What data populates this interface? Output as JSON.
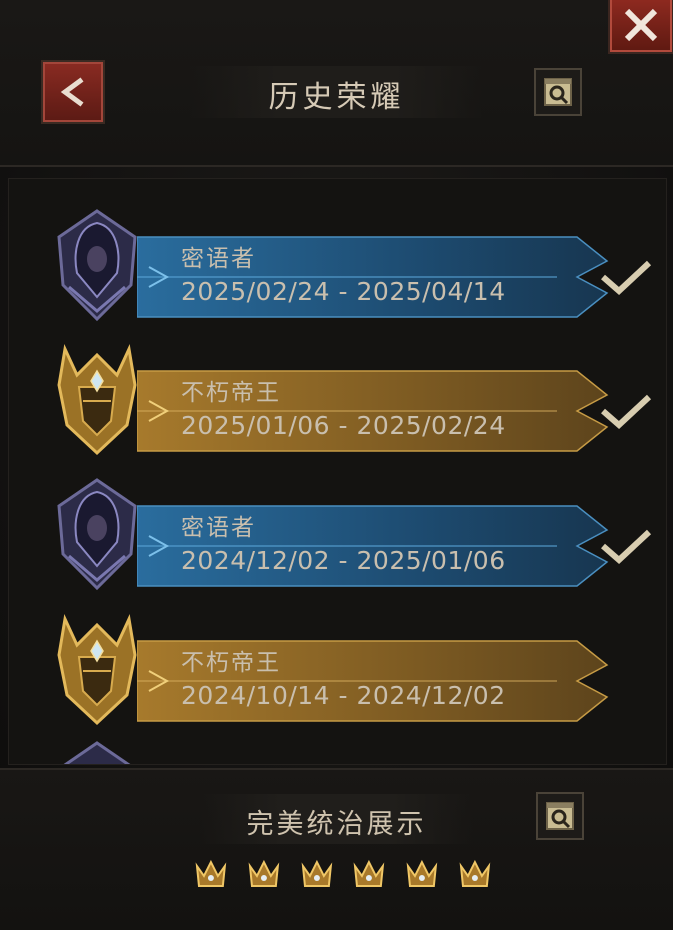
{
  "header": {
    "title": "历史荣耀"
  },
  "icons": {
    "back": "chevron-left-icon",
    "close": "close-icon",
    "search": "search-scroll-icon",
    "check": "check-icon"
  },
  "colors": {
    "blue_banner": "#1f4f77",
    "gold_banner": "#8a6425",
    "close_red": "#8f2a20",
    "text_light": "#d6cab6"
  },
  "history": [
    {
      "rank": "密语者",
      "dates": "2025/02/24 - 2025/04/14",
      "tier": "blue",
      "checked": true
    },
    {
      "rank": "不朽帝王",
      "dates": "2025/01/06 - 2025/02/24",
      "tier": "gold",
      "checked": true
    },
    {
      "rank": "密语者",
      "dates": "2024/12/02 - 2025/01/06",
      "tier": "blue",
      "checked": true
    },
    {
      "rank": "不朽帝王",
      "dates": "2024/10/14 - 2024/12/02",
      "tier": "gold",
      "checked": false
    }
  ],
  "footer": {
    "title": "完美统治展示",
    "crown_count": 6
  }
}
